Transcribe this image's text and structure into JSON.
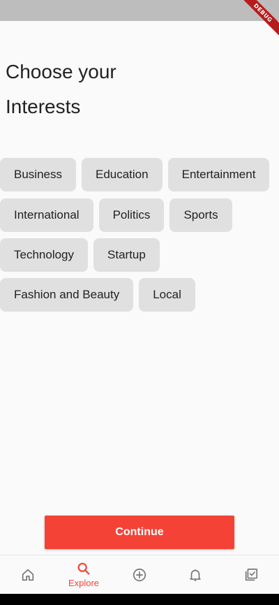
{
  "debug_banner": "DEBUG",
  "title": {
    "line1": "Choose your",
    "line2": "Interests"
  },
  "chips": {
    "row1": [
      "Business",
      "Education",
      "Entertainment"
    ],
    "row2": [
      "International",
      "Politics",
      "Sports"
    ],
    "row3": [
      "Technology",
      "Startup"
    ],
    "row4": [
      "Fashion and Beauty",
      "Local"
    ]
  },
  "continue_label": "Continue",
  "nav": {
    "active_index": 1,
    "items": [
      {
        "icon": "home-icon",
        "label": ""
      },
      {
        "icon": "search-icon",
        "label": "Explore"
      },
      {
        "icon": "add-circle-icon",
        "label": ""
      },
      {
        "icon": "bell-icon",
        "label": ""
      },
      {
        "icon": "checklist-icon",
        "label": ""
      }
    ]
  },
  "colors": {
    "accent": "#f44336",
    "chip_bg": "#e0e0e0",
    "icon_inactive": "#757575"
  }
}
